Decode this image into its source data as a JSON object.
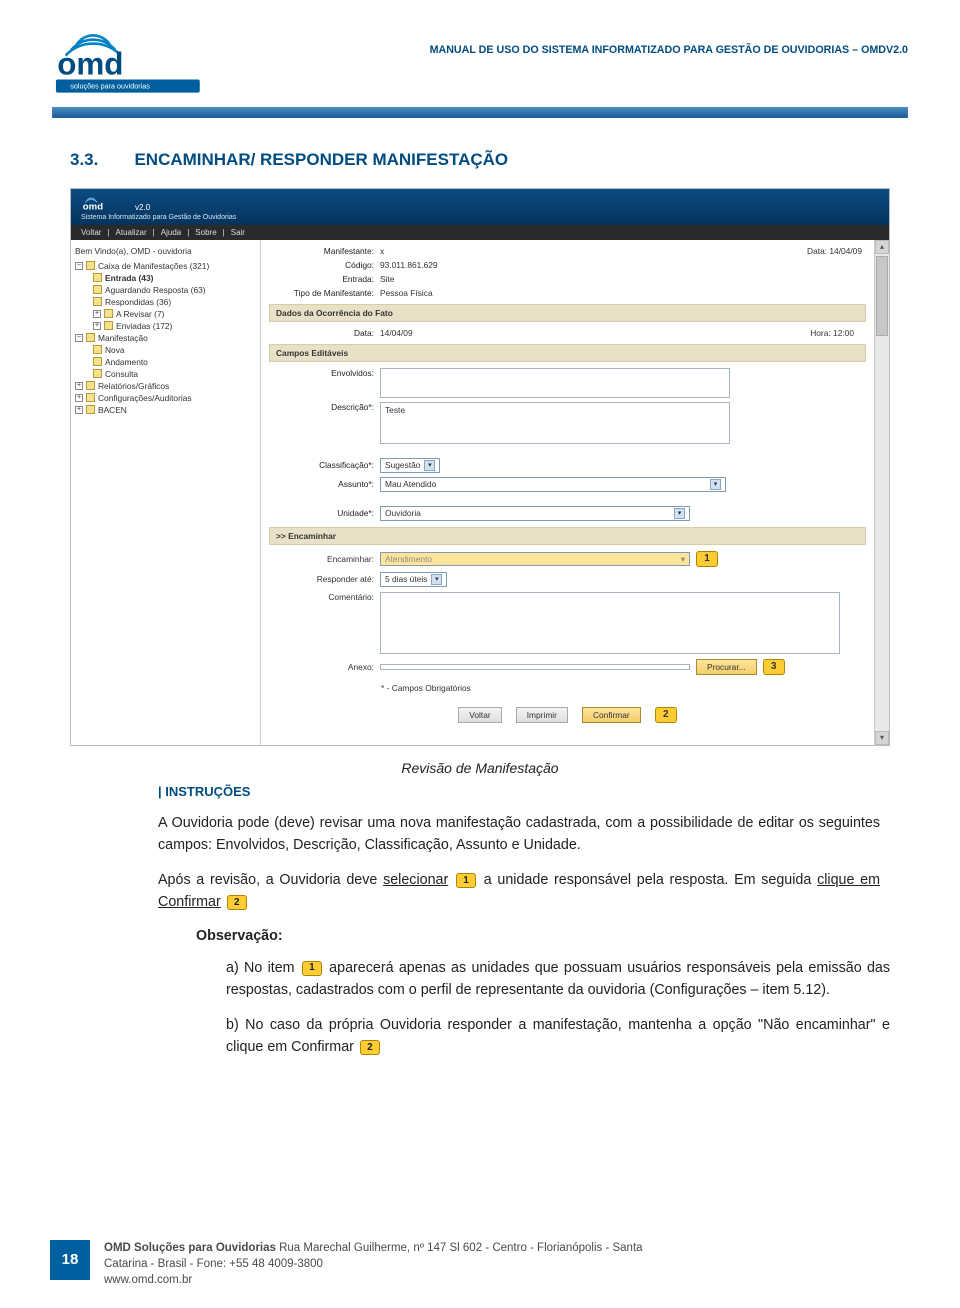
{
  "colors": {
    "brand_blue": "#004c80",
    "badge_bg": "#ffcc33",
    "footer_blue": "#005f9e"
  },
  "manual_title": "MANUAL DE USO DO SISTEMA INFORMATIZADO PARA GESTÃO DE OUVIDORIAS – OMDV2.0",
  "logo": {
    "word": "omd",
    "tagline": "soluções para ouvidorias",
    "version": "v2.0"
  },
  "section": {
    "num": "3.3.",
    "title": "ENCAMINHAR/ RESPONDER MANIFESTAÇÃO"
  },
  "app": {
    "subtitle": "Sistema Informatizado para Gestão de Ouvidorias",
    "menu": [
      "Voltar",
      "|",
      "Atualizar",
      "|",
      "Ajuda",
      "|",
      "Sobre",
      "|",
      "Sair"
    ],
    "tree": {
      "welcome": "Bem Vindo(a), OMD - ouvidoria",
      "caixa": "Caixa de Manifestações (321)",
      "entrada": "Entrada (43)",
      "aguardando": "Aguardando Resposta (63)",
      "respondidas": "Respondidas (36)",
      "arevisar": "A Revisar (7)",
      "enviadas": "Enviadas (172)",
      "manifestacao": "Manifestação",
      "nova": "Nova",
      "andamento": "Andamento",
      "consulta": "Consulta",
      "relatorios": "Relatórios/Gráficos",
      "config": "Configurações/Auditorias",
      "bacen": "BACEN"
    },
    "form": {
      "labels": {
        "manifestante": "Manifestante:",
        "codigo": "Código:",
        "entrada": "Entrada:",
        "tipo_manifestante": "Tipo de Manifestante:",
        "data_lbl": "Data:",
        "hora_lbl": "Hora:",
        "envolvidos": "Envolvidos:",
        "descricao": "Descrição*:",
        "classificacao": "Classificação*:",
        "assunto": "Assunto*:",
        "unidade": "Unidade*:",
        "encaminhar_header": ">> Encaminhar",
        "encaminhar": "Encaminhar:",
        "responder_ate": "Responder até:",
        "comentario": "Comentário:",
        "anexo": "Anexo:",
        "obrig": "* - Campos Obrigatórios",
        "section_dados": "Dados da Ocorrência do Fato",
        "section_campos": "Campos Editáveis"
      },
      "values": {
        "manifestante": "x",
        "codigo": "93.011.861.629",
        "entrada": "Site",
        "tipo_manifestante": "Pessoa Física",
        "data_label_right": "Data: 14/04/09",
        "data": "14/04/09",
        "hora": "12:00",
        "descricao_text": "Teste",
        "classificacao": "Sugestão",
        "assunto": "Mau Atendido",
        "unidade": "Ouvidoria",
        "encaminhar": "Atendimento",
        "responder_ate": "5 dias úteis"
      },
      "buttons": {
        "procurar": "Procurar...",
        "voltar": "Voltar",
        "imprimir": "Imprimir",
        "confirmar": "Confirmar"
      },
      "badges": {
        "b1": "1",
        "b2": "2",
        "b3": "3"
      }
    }
  },
  "caption": "Revisão de Manifestação",
  "instructions_heading": "| INSTRUÇÕES",
  "paragraphs": {
    "p1": "A Ouvidoria pode (deve) revisar uma nova manifestação cadastrada, com a possibilidade de editar os seguintes campos: Envolvidos, Descrição, Classificação, Assunto e Unidade.",
    "p2_a": "Após a revisão, a Ouvidoria deve ",
    "p2_u1": "selecionar",
    "p2_b": " a unidade responsável pela resposta. Em seguida ",
    "p2_u2": "clique em Confirmar"
  },
  "observ": "Observação:",
  "list": {
    "a_pre": "a) No item ",
    "a_post": " aparecerá apenas as unidades que possuam usuários responsáveis pela emissão das respostas, cadastrados com o perfil de representante da ouvidoria (Configurações – item 5.12).",
    "b_pre": "b) No caso da própria Ouvidoria responder a manifestação, mantenha a opção \"Não encaminhar\" e clique em Confirmar "
  },
  "footer": {
    "page": "18",
    "company": "OMD Soluções para Ouvidorias",
    "addr1": " Rua Marechal Guilherme, nº 147 Sl 602 - Centro - Florianópolis - Santa",
    "addr2": "Catarina - Brasil - Fone: +55 48 4009-3800",
    "site": "www.omd.com.br"
  }
}
